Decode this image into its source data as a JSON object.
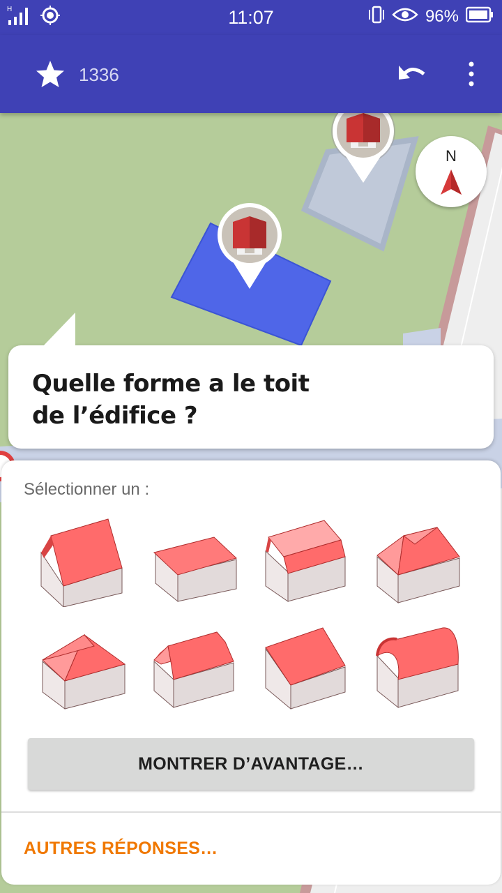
{
  "status_bar": {
    "time": "11:07",
    "network_type": "H",
    "battery": "96%",
    "icons": [
      "signal-icon",
      "location-icon",
      "vibrate-icon",
      "eye-icon",
      "battery-icon"
    ]
  },
  "app_bar": {
    "star_count": "1336",
    "icons": [
      "star-icon",
      "undo-icon",
      "more-vert-icon"
    ]
  },
  "compass": {
    "label": "N"
  },
  "quest": {
    "question": "Quelle forme a le toit de l’édifice ?",
    "select_label": "Sélectionner un :",
    "roof_options": [
      "gabled-roof",
      "skillion-roof",
      "gambrel-roof",
      "hipped-roof",
      "pyramidal-roof",
      "half-hipped-roof",
      "flat-slope-roof",
      "round-roof"
    ],
    "show_more_label": "MONTRER D’AVANTAGE…",
    "other_answers_label": "AUTRES RÉPONSES…"
  },
  "colors": {
    "primary": "#3f41b5",
    "accent_orange": "#f07800",
    "roof_red": "#ff6b6b",
    "selected_building": "#4f66e8",
    "map_green": "#b5cc9a"
  }
}
